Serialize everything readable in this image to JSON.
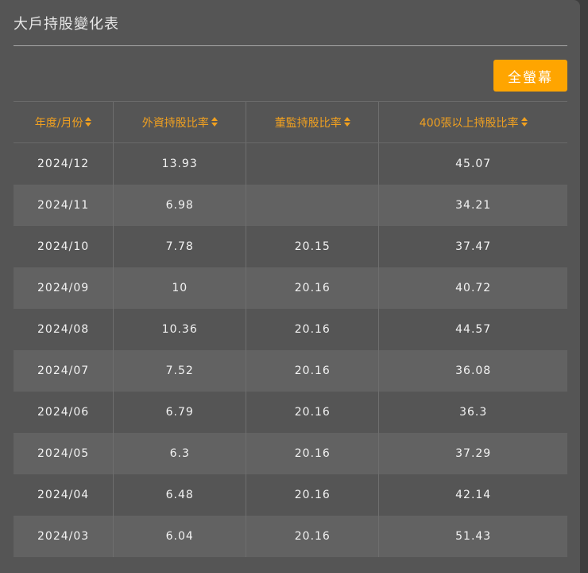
{
  "title": "大戶持股變化表",
  "fullscreen_label": "全螢幕",
  "columns": [
    "年度/月份",
    "外資持股比率",
    "董監持股比率",
    "400張以上持股比率"
  ],
  "rows": [
    [
      "2024/12",
      "13.93",
      "",
      "45.07"
    ],
    [
      "2024/11",
      "6.98",
      "",
      "34.21"
    ],
    [
      "2024/10",
      "7.78",
      "20.15",
      "37.47"
    ],
    [
      "2024/09",
      "10",
      "20.16",
      "40.72"
    ],
    [
      "2024/08",
      "10.36",
      "20.16",
      "44.57"
    ],
    [
      "2024/07",
      "7.52",
      "20.16",
      "36.08"
    ],
    [
      "2024/06",
      "6.79",
      "20.16",
      "36.3"
    ],
    [
      "2024/05",
      "6.3",
      "20.16",
      "37.29"
    ],
    [
      "2024/04",
      "6.48",
      "20.16",
      "42.14"
    ],
    [
      "2024/03",
      "6.04",
      "20.16",
      "51.43"
    ]
  ],
  "colors": {
    "accent": "#ffa500",
    "header_text": "#f0a020",
    "background": "#555555",
    "alt_row": "#626262"
  }
}
